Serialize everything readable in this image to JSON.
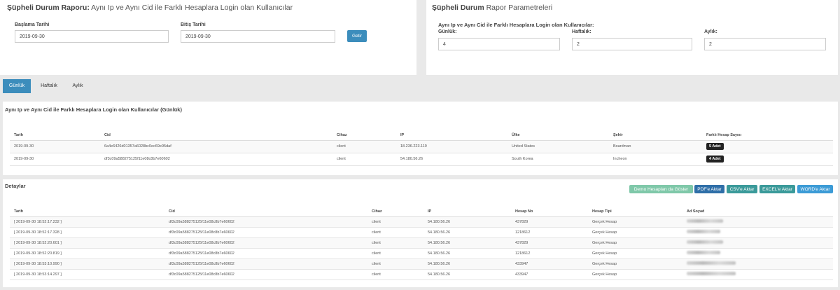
{
  "report": {
    "title_bold": "Şüpheli Durum Raporu:",
    "title_rest": " Aynı Ip ve Aynı Cid ile Farklı Hesaplara Login olan Kullanıcılar",
    "start_label": "Başlama Tarihi",
    "start_value": "2019-09-30",
    "end_label": "Bitiş Tarihi",
    "end_value": "2019-09-30",
    "fetch_button": "Getir"
  },
  "params": {
    "title_bold": "Şüpheli Durum",
    "title_rest": " Rapor Parametreleri",
    "subtitle": "Aynı Ip ve Aynı Cid ile Farklı Hesaplara Login olan Kullanıcılar:",
    "daily_label": "Günlük:",
    "daily_value": "4",
    "weekly_label": "Haftalık:",
    "weekly_value": "2",
    "monthly_label": "Aylık:",
    "monthly_value": "2"
  },
  "tabs": [
    "Günlük",
    "Haftalık",
    "Aylık"
  ],
  "summary": {
    "title": "Aynı Ip ve Aynı Cid ile Farklı Hesaplara Login olan Kullanıcılar (Günlük)",
    "headers": [
      "Tarih",
      "Cid",
      "Cihaz",
      "IP",
      "Ülke",
      "Şehir",
      "Farklı Hesap Sayısı"
    ],
    "rows": [
      {
        "date": "2019-09-30",
        "cid": "6a4e6426d01357a6028bc0ec69e95daf",
        "device": "client",
        "ip": "18.236.223.119",
        "country": "United States",
        "city": "Boardman",
        "count": "5 Adet"
      },
      {
        "date": "2019-09-30",
        "cid": "df3c09a588275125f11e08c8b7e60602",
        "device": "client",
        "ip": "54.180.56.26",
        "country": "South Korea",
        "city": "Incheon",
        "count": "4 Adet"
      }
    ]
  },
  "details": {
    "title": "Detaylar",
    "buttons": {
      "demo": "Demo Hesapları da Göster",
      "pdf": "PDF'e Aktar",
      "csv": "CSV'e Aktar",
      "excel": "EXCEL'e Aktar",
      "word": "WORD'e Aktar"
    },
    "button_colors": {
      "demo": "#7fc8a9",
      "pdf": "#2f6fa8",
      "csv": "#3b9a9a",
      "excel": "#3b9a9a",
      "word": "#3c9bd6"
    },
    "headers": [
      "Tarih",
      "Cid",
      "Cihaz",
      "IP",
      "Hesap No",
      "Hesap Tipi",
      "Ad Soyad"
    ],
    "rows": [
      {
        "date": "[ 2019-09-30 18:52:17.232 ]",
        "cid": "df3c09a588275125f11e08c8b7e60602",
        "device": "client",
        "ip": "54.180.56.26",
        "account_no": "437829",
        "account_type": "Gerçek Hesap"
      },
      {
        "date": "[ 2019-09-30 18:52:17.328 ]",
        "cid": "df3c09a588275125f11e08c8b7e60602",
        "device": "client",
        "ip": "54.180.56.26",
        "account_no": "1218612",
        "account_type": "Gerçek Hesap"
      },
      {
        "date": "[ 2019-09-30 18:52:20.601 ]",
        "cid": "df3c09a588275125f11e08c8b7e60602",
        "device": "client",
        "ip": "54.180.56.26",
        "account_no": "437829",
        "account_type": "Gerçek Hesap"
      },
      {
        "date": "[ 2019-09-30 18:52:20.819 ]",
        "cid": "df3c09a588275125f11e08c8b7e60602",
        "device": "client",
        "ip": "54.180.56.26",
        "account_no": "1218612",
        "account_type": "Gerçek Hesap"
      },
      {
        "date": "[ 2019-09-30 18:53:10.990 ]",
        "cid": "df3c09a588275125f11e08c8b7e60602",
        "device": "client",
        "ip": "54.180.56.26",
        "account_no": "433947",
        "account_type": "Gerçek Hesap"
      },
      {
        "date": "[ 2019-09-30 18:53:14.297 ]",
        "cid": "df3c09a588275125f11e08c8b7e60602",
        "device": "client",
        "ip": "54.180.56.26",
        "account_no": "433947",
        "account_type": "Gerçek Hesap"
      }
    ]
  },
  "colors": {
    "accent": "#3c8dbc",
    "badge": "#222222"
  }
}
